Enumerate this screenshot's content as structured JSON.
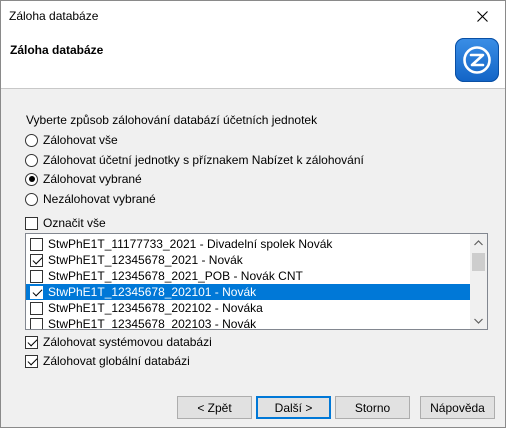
{
  "window": {
    "title": "Záloha databáze"
  },
  "header": {
    "title": "Záloha databáze"
  },
  "instruction": "Vyberte způsob zálohování databází účetních jednotek",
  "options": [
    {
      "label": "Zálohovat vše",
      "checked": false
    },
    {
      "label": "Zálohovat účetní jednotky s příznakem Nabízet k zálohování",
      "checked": false
    },
    {
      "label": "Zálohovat vybrané",
      "checked": true
    },
    {
      "label": "Nezálohovat vybrané",
      "checked": false
    }
  ],
  "select_all": {
    "label": "Označit vše",
    "checked": false
  },
  "databases": [
    {
      "label": "StwPhE1T_11177733_2021 - Divadelní spolek Novák",
      "checked": false,
      "selected": false
    },
    {
      "label": "StwPhE1T_12345678_2021 - Novák",
      "checked": true,
      "selected": false
    },
    {
      "label": "StwPhE1T_12345678_2021_POB - Novák CNT",
      "checked": false,
      "selected": false
    },
    {
      "label": "StwPhE1T_12345678_202101 - Novák",
      "checked": true,
      "selected": true
    },
    {
      "label": "StwPhE1T_12345678_202102 - Nováka",
      "checked": false,
      "selected": false
    },
    {
      "label": "StwPhE1T_12345678_202103 - Novák",
      "checked": false,
      "selected": false
    }
  ],
  "system_backup": {
    "label": "Zálohovat systémovou databázi",
    "checked": true
  },
  "global_backup": {
    "label": "Zálohovat globální databázi",
    "checked": true
  },
  "buttons": {
    "back": "< Zpět",
    "next": "Další >",
    "cancel": "Storno",
    "help": "Nápověda"
  },
  "icons": {
    "close": "close-icon",
    "logo": "app-logo-icon",
    "scroll_up": "chevron-up-icon",
    "scroll_down": "chevron-down-icon"
  },
  "colors": {
    "selection": "#0078d7",
    "logo": "#1a73d9"
  }
}
